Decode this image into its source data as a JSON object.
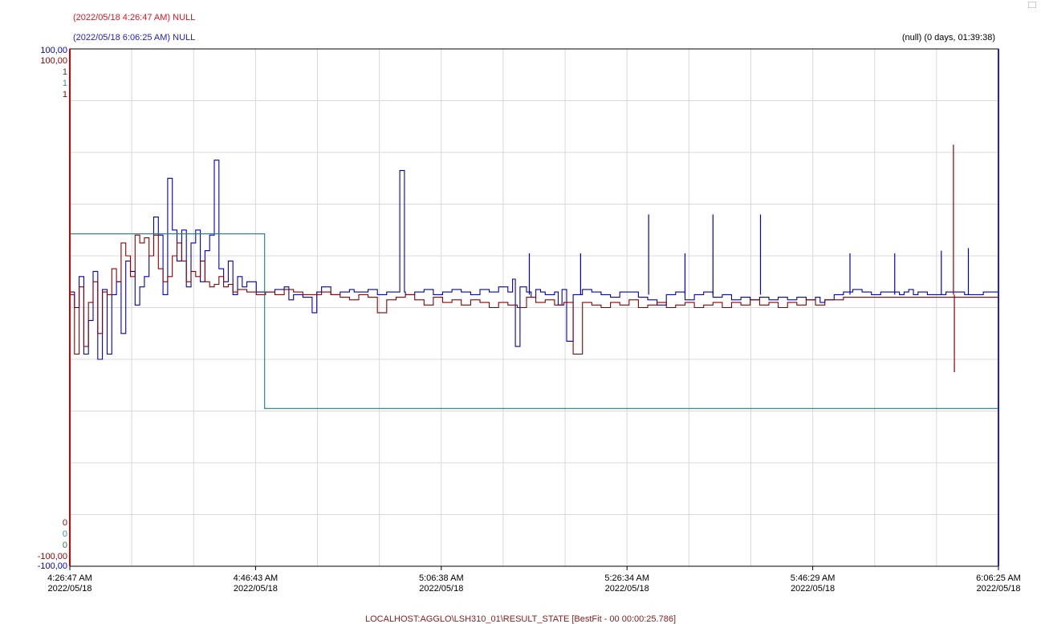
{
  "header": {
    "cursor_start": "(2022/05/18 4:26:47 AM) NULL",
    "cursor_end": "(2022/05/18 6:06:25 AM) NULL",
    "duration": "(null) (0 days, 01:39:38)"
  },
  "footer": {
    "tag": "LOCALHOST:AGGLO\\LSH310_01\\RESULT_STATE [BestFit - 00 00:00:25.786]"
  },
  "colors": {
    "red_series": "#8b0000",
    "blue_series": "#0000c0",
    "teal_series": "#1e7f7f",
    "green_series": "#008060",
    "grid": "#d8d8d8",
    "cursor_start": "#cc0000",
    "cursor_end": "#2020d0"
  },
  "chart_data": {
    "type": "line",
    "x_ticks": [
      {
        "time": "4:26:47 AM",
        "date": "2022/05/18"
      },
      {
        "time": "4:46:43 AM",
        "date": "2022/05/18"
      },
      {
        "time": "5:06:38 AM",
        "date": "2022/05/18"
      },
      {
        "time": "5:26:34 AM",
        "date": "2022/05/18"
      },
      {
        "time": "5:46:29 AM",
        "date": "2022/05/18"
      },
      {
        "time": "6:06:25 AM",
        "date": "2022/05/18"
      }
    ],
    "x_range_minutes": [
      0,
      99.63
    ],
    "y_scales": [
      {
        "color": "#0000c0",
        "max": "100,00",
        "min": "-100,00",
        "ylim": [
          -100,
          100
        ]
      },
      {
        "color": "#8b0000",
        "max": "100,00",
        "min": "-100,00",
        "ylim": [
          -100,
          100
        ]
      },
      {
        "color": "#404040",
        "max": "1",
        "min": "0",
        "ylim": [
          0,
          1
        ]
      },
      {
        "color": "#2f8fb0",
        "max": "1",
        "min": "0",
        "ylim": [
          0,
          1
        ]
      },
      {
        "color": "#8b0000",
        "max": "1",
        "min": "0",
        "ylim": [
          0,
          1
        ]
      }
    ],
    "y_extra_zero": {
      "color": "#2a7a3a",
      "label": "0"
    },
    "grid": true,
    "series": [
      {
        "color": "#0000c0",
        "step": true,
        "points": [
          [
            0,
            6
          ],
          [
            0.5,
            0
          ],
          [
            1,
            12
          ],
          [
            1.5,
            -18
          ],
          [
            2,
            -5
          ],
          [
            2.5,
            14
          ],
          [
            3,
            -20
          ],
          [
            3.5,
            7
          ],
          [
            4,
            -18
          ],
          [
            4.5,
            5
          ],
          [
            5,
            10
          ],
          [
            5.5,
            -10
          ],
          [
            6,
            18
          ],
          [
            6.5,
            14
          ],
          [
            7,
            1
          ],
          [
            7.5,
            8
          ],
          [
            8,
            12
          ],
          [
            8.5,
            20
          ],
          [
            9,
            35
          ],
          [
            9.5,
            28
          ],
          [
            10,
            5
          ],
          [
            10.5,
            50
          ],
          [
            11,
            30
          ],
          [
            11.5,
            18
          ],
          [
            12,
            30
          ],
          [
            12.5,
            8
          ],
          [
            13,
            25
          ],
          [
            13.5,
            30
          ],
          [
            14,
            10
          ],
          [
            14.5,
            22
          ],
          [
            15,
            28
          ],
          [
            15.5,
            57
          ],
          [
            16,
            15
          ],
          [
            16.5,
            10
          ],
          [
            17,
            18
          ],
          [
            17.5,
            5
          ],
          [
            18,
            12
          ],
          [
            18.5,
            8
          ],
          [
            19,
            10
          ],
          [
            20,
            6
          ],
          [
            21,
            6
          ],
          [
            22,
            7
          ],
          [
            23,
            8
          ],
          [
            23.5,
            3
          ],
          [
            24,
            5
          ],
          [
            25,
            4
          ],
          [
            26,
            -2
          ],
          [
            26.5,
            6
          ],
          [
            27,
            8
          ],
          [
            28,
            5
          ],
          [
            29,
            6
          ],
          [
            30,
            7
          ],
          [
            30.5,
            6
          ],
          [
            31,
            6
          ],
          [
            32,
            7
          ],
          [
            33,
            5
          ],
          [
            34,
            6
          ],
          [
            35,
            6
          ],
          [
            35.4,
            53
          ],
          [
            35.9,
            6
          ],
          [
            36,
            5
          ],
          [
            37,
            6
          ],
          [
            38,
            7
          ],
          [
            39,
            5
          ],
          [
            40,
            6
          ],
          [
            41,
            7
          ],
          [
            42,
            6
          ],
          [
            43,
            5
          ],
          [
            44,
            7
          ],
          [
            45,
            6
          ],
          [
            46,
            8
          ],
          [
            47,
            6
          ],
          [
            47.5,
            11
          ],
          [
            47.8,
            -15
          ],
          [
            48.3,
            8
          ],
          [
            49,
            6
          ],
          [
            49.5,
            4
          ],
          [
            50,
            7
          ],
          [
            50.5,
            6
          ],
          [
            51,
            5
          ],
          [
            52,
            6
          ],
          [
            52.4,
            1
          ],
          [
            52.8,
            7
          ],
          [
            53.3,
            -13
          ],
          [
            54,
            5
          ],
          [
            55,
            7
          ],
          [
            56,
            6
          ],
          [
            57,
            5
          ],
          [
            58,
            4
          ],
          [
            59,
            6
          ],
          [
            60,
            6
          ],
          [
            61,
            4
          ],
          [
            62,
            3
          ],
          [
            63,
            1
          ],
          [
            64,
            5
          ],
          [
            65,
            6
          ],
          [
            66,
            3
          ],
          [
            67,
            5
          ],
          [
            68,
            6
          ],
          [
            69,
            4
          ],
          [
            70,
            5
          ],
          [
            71,
            3
          ],
          [
            72,
            4
          ],
          [
            73,
            3
          ],
          [
            74,
            4
          ],
          [
            75,
            3
          ],
          [
            76,
            4
          ],
          [
            77,
            3
          ],
          [
            78,
            4
          ],
          [
            79,
            3
          ],
          [
            80,
            4
          ],
          [
            80.5,
            2
          ],
          [
            81,
            3
          ],
          [
            82,
            5
          ],
          [
            83,
            6
          ],
          [
            84,
            7
          ],
          [
            85,
            6
          ],
          [
            86,
            5
          ],
          [
            87,
            6
          ],
          [
            88,
            6
          ],
          [
            89,
            5
          ],
          [
            89.5,
            6
          ],
          [
            90,
            7
          ],
          [
            90.5,
            5
          ],
          [
            91,
            6
          ],
          [
            92,
            5
          ],
          [
            93,
            5
          ],
          [
            94,
            6
          ],
          [
            95,
            6
          ],
          [
            96,
            5
          ],
          [
            97,
            5
          ],
          [
            98,
            6
          ],
          [
            99,
            6
          ],
          [
            99.63,
            6
          ]
        ]
      },
      {
        "color": "#8b0000",
        "step": true,
        "points": [
          [
            0,
            5
          ],
          [
            0.5,
            -18
          ],
          [
            1,
            8
          ],
          [
            1.5,
            -15
          ],
          [
            2,
            2
          ],
          [
            2.5,
            10
          ],
          [
            3,
            -10
          ],
          [
            3.5,
            6
          ],
          [
            4,
            5
          ],
          [
            4.5,
            15
          ],
          [
            5,
            10
          ],
          [
            5.5,
            25
          ],
          [
            6,
            20
          ],
          [
            6.5,
            12
          ],
          [
            7,
            28
          ],
          [
            7.5,
            25
          ],
          [
            8,
            27
          ],
          [
            8.5,
            20
          ],
          [
            9,
            28
          ],
          [
            9.5,
            15
          ],
          [
            10,
            10
          ],
          [
            10.5,
            12
          ],
          [
            11,
            20
          ],
          [
            11.5,
            25
          ],
          [
            12,
            18
          ],
          [
            12.5,
            10
          ],
          [
            13,
            14
          ],
          [
            13.5,
            12
          ],
          [
            14,
            18
          ],
          [
            14.5,
            10
          ],
          [
            15,
            8
          ],
          [
            15.5,
            9
          ],
          [
            16,
            12
          ],
          [
            16.5,
            8
          ],
          [
            17,
            9
          ],
          [
            17.5,
            6
          ],
          [
            18,
            7
          ],
          [
            19,
            6
          ],
          [
            20,
            5
          ],
          [
            21,
            6
          ],
          [
            22,
            5
          ],
          [
            23,
            7
          ],
          [
            24,
            6
          ],
          [
            25,
            5
          ],
          [
            26,
            5
          ],
          [
            27,
            6
          ],
          [
            28,
            5
          ],
          [
            29,
            4
          ],
          [
            30,
            3
          ],
          [
            31,
            5
          ],
          [
            32,
            4
          ],
          [
            33,
            -2
          ],
          [
            34,
            3
          ],
          [
            35,
            4
          ],
          [
            36,
            5
          ],
          [
            37,
            3
          ],
          [
            38,
            1
          ],
          [
            39,
            4
          ],
          [
            40,
            2
          ],
          [
            41,
            3
          ],
          [
            42,
            1
          ],
          [
            43,
            3
          ],
          [
            44,
            2
          ],
          [
            45,
            0
          ],
          [
            46,
            2
          ],
          [
            47,
            1
          ],
          [
            48,
            0
          ],
          [
            49,
            4
          ],
          [
            50,
            2
          ],
          [
            51,
            3
          ],
          [
            52,
            1
          ],
          [
            53,
            2
          ],
          [
            54,
            -18
          ],
          [
            55,
            2
          ],
          [
            56,
            1
          ],
          [
            57,
            0
          ],
          [
            58,
            2
          ],
          [
            59,
            1
          ],
          [
            60,
            3
          ],
          [
            61,
            0
          ],
          [
            62,
            1
          ],
          [
            63,
            2
          ],
          [
            64,
            0
          ],
          [
            65,
            1
          ],
          [
            66,
            2
          ],
          [
            67,
            0
          ],
          [
            68,
            1
          ],
          [
            69,
            2
          ],
          [
            70,
            0
          ],
          [
            71,
            2
          ],
          [
            72,
            1
          ],
          [
            73,
            3
          ],
          [
            74,
            1
          ],
          [
            75,
            2
          ],
          [
            76,
            0
          ],
          [
            77,
            2
          ],
          [
            78,
            1
          ],
          [
            79,
            3
          ],
          [
            80,
            1
          ],
          [
            81,
            3
          ],
          [
            82,
            3
          ],
          [
            83,
            4
          ],
          [
            84,
            4
          ],
          [
            85,
            4
          ],
          [
            86,
            4
          ],
          [
            87,
            4
          ],
          [
            88,
            4
          ],
          [
            89,
            4
          ],
          [
            90,
            4
          ],
          [
            91,
            4
          ],
          [
            92,
            4
          ],
          [
            93,
            4
          ],
          [
            94,
            4
          ],
          [
            95,
            4
          ],
          [
            96,
            4
          ],
          [
            97,
            4
          ],
          [
            98,
            4
          ],
          [
            99,
            4
          ],
          [
            99.63,
            4
          ]
        ]
      },
      {
        "color": "#1e7f7f",
        "step": true,
        "points": [
          [
            0,
            28.5
          ],
          [
            20.9,
            28.5
          ],
          [
            20.9,
            -39
          ],
          [
            99.63,
            -39
          ]
        ]
      }
    ]
  }
}
